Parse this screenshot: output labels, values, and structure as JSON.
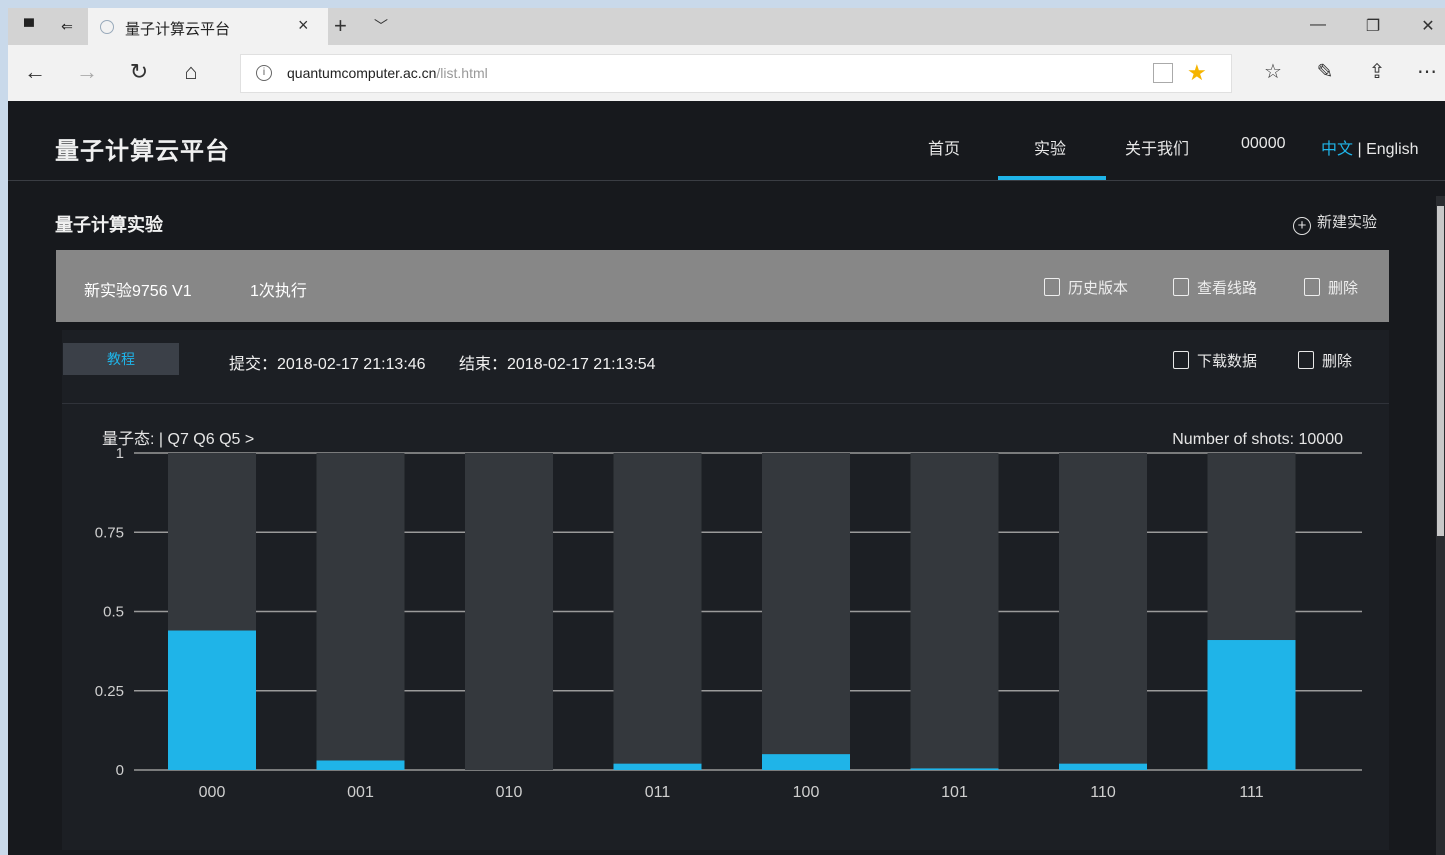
{
  "browser": {
    "tab_title": "量子计算云平台",
    "url_host": "quantumcomputer.ac.cn",
    "url_path": "/list.html"
  },
  "header": {
    "brand": "量子计算云平台",
    "nav": [
      "首页",
      "实验",
      "关于我们",
      "00000"
    ],
    "active_nav": "实验",
    "lang_zh": "中文",
    "lang_sep": "|",
    "lang_en": "English"
  },
  "section": {
    "title": "量子计算实验",
    "new_experiment": "新建实验"
  },
  "experiment": {
    "name": "新实验9756 V1",
    "runs": "1次执行",
    "actions": [
      "历史版本",
      "查看线路",
      "删除"
    ]
  },
  "run": {
    "status": "教程",
    "submit": "提交：2018-02-17 21:13:46",
    "end": "结束：2018-02-17 21:13:54",
    "actions": [
      "下载数据",
      "删除"
    ]
  },
  "chart_data": {
    "type": "bar",
    "title": "量子态: | Q7 Q6 Q5 >",
    "shots_label": "Number of shots: 10000",
    "categories": [
      "000",
      "001",
      "010",
      "011",
      "100",
      "101",
      "110",
      "111"
    ],
    "values": [
      0.44,
      0.03,
      0.0,
      0.02,
      0.05,
      0.005,
      0.02,
      0.41
    ],
    "ylim": [
      0,
      1
    ],
    "yticks": [
      "0",
      "0.25",
      "0.5",
      "0.75",
      "1"
    ],
    "bar_color": "#1fb4e8",
    "track_color": "#34383d",
    "grid": true
  }
}
